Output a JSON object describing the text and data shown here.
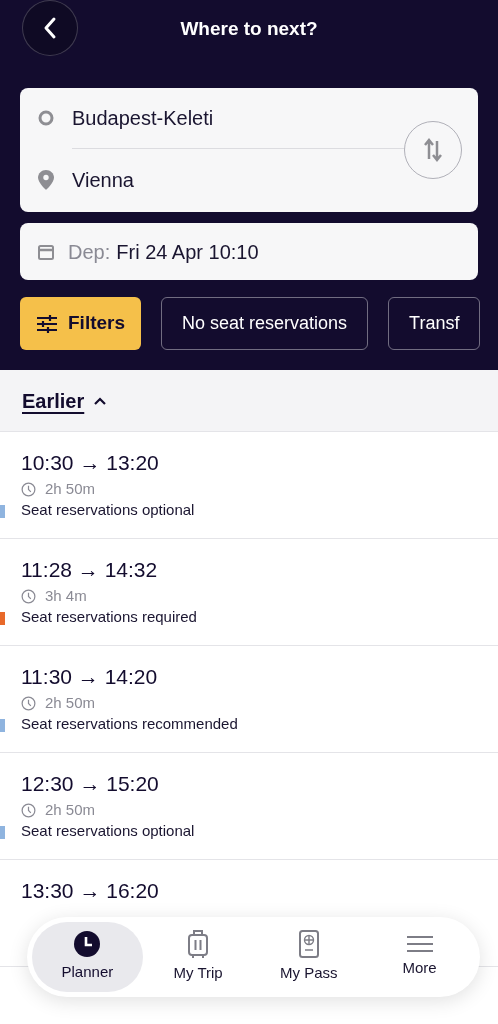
{
  "header": {
    "title": "Where to next?"
  },
  "route": {
    "from": "Budapest-Keleti",
    "to": "Vienna"
  },
  "departure": {
    "label": "Dep:",
    "value": "Fri 24 Apr 10:10"
  },
  "filters": [
    {
      "kind": "primary",
      "label": "Filters"
    },
    {
      "kind": "chip",
      "label": "No seat reservations"
    },
    {
      "kind": "chip",
      "label": "Transf"
    }
  ],
  "earlier": {
    "label": "Earlier",
    "expanded": true
  },
  "journeys": [
    {
      "times": "10:30 → 13:20",
      "duration": "2h 50m",
      "reservation": "Seat reservations optional",
      "color": "#8fb4df"
    },
    {
      "times": "11:28 → 14:32",
      "duration": "3h 4m",
      "reservation": "Seat reservations required",
      "color": "#e8692a"
    },
    {
      "times": "11:30 → 14:20",
      "duration": "2h 50m",
      "reservation": "Seat reservations recommended",
      "color": "#8fb4df"
    },
    {
      "times": "12:30 → 15:20",
      "duration": "2h 50m",
      "reservation": "Seat reservations optional",
      "color": "#8fb4df"
    },
    {
      "times": "13:30 → 16:20"
    }
  ],
  "tabs": [
    {
      "kind": "planner",
      "label": "Planner",
      "selected": true
    },
    {
      "kind": "trip",
      "label": "My Trip",
      "selected": false
    },
    {
      "kind": "pass",
      "label": "My Pass",
      "selected": false
    },
    {
      "kind": "more",
      "label": "More",
      "selected": false
    }
  ]
}
